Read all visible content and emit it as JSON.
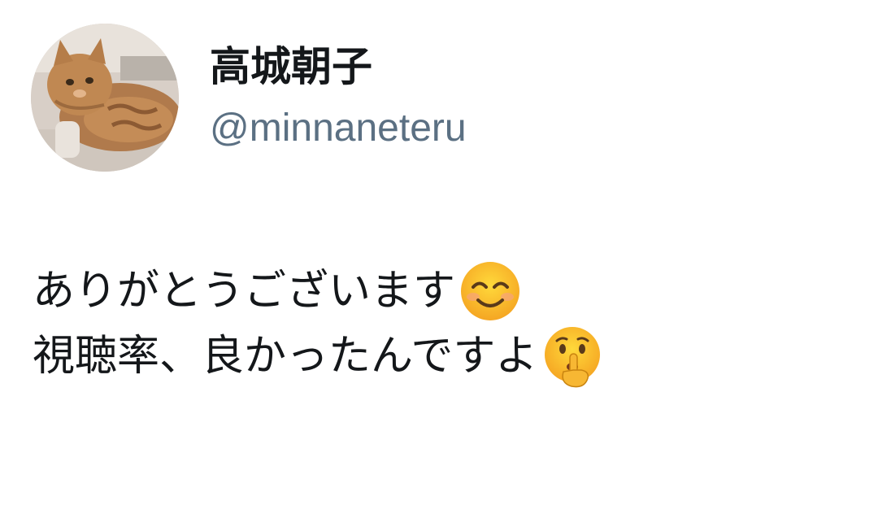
{
  "author": {
    "display_name": "高城朝子",
    "handle": "@minnaneteru",
    "avatar_icon": "cat-photo-avatar"
  },
  "tweet": {
    "line1_text": "ありがとうございます",
    "line1_emoji": "smiling-face-with-smiling-eyes-emoji",
    "line2_text": "視聴率、良かったんですよ",
    "line2_emoji": "shushing-face-emoji"
  },
  "colors": {
    "text": "#14171a",
    "handle": "#5b7083",
    "background": "#ffffff",
    "emoji_yellow": "#fcc21b"
  }
}
